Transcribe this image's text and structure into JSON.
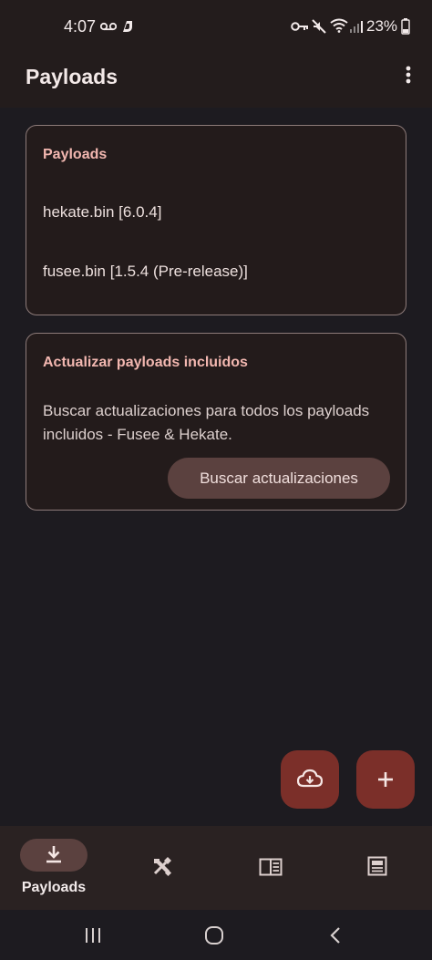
{
  "status_bar": {
    "time": "4:07",
    "battery": "23%",
    "icons": [
      "voicemail-icon",
      "app-d-icon",
      "key-icon",
      "mute-icon",
      "wifi-icon",
      "signal-icon",
      "battery-icon"
    ]
  },
  "app_bar": {
    "title": "Payloads",
    "menu_icon": "more-vert-icon"
  },
  "payloads_card": {
    "title": "Payloads",
    "items": [
      "hekate.bin [6.0.4]",
      "fusee.bin [1.5.4 (Pre-release)]"
    ]
  },
  "update_card": {
    "title": "Actualizar payloads incluidos",
    "description": "Buscar actualizaciones para todos los payloads incluidos - Fusee & Hekate.",
    "button_label": "Buscar actualizaciones"
  },
  "fabs": [
    {
      "icon": "cloud-download-icon"
    },
    {
      "icon": "plus-icon"
    }
  ],
  "bottom_nav": {
    "items": [
      {
        "icon": "download-icon",
        "label": "Payloads",
        "active": true
      },
      {
        "icon": "tools-icon",
        "label": "",
        "active": false
      },
      {
        "icon": "split-view-icon",
        "label": "",
        "active": false
      },
      {
        "icon": "article-icon",
        "label": "",
        "active": false
      }
    ]
  },
  "colors": {
    "background": "#1d1b20",
    "surface": "#231c1c",
    "accent": "#f2b7b0",
    "fab": "#7b2f29",
    "tonal": "#5b413f",
    "outline": "#8d7b79"
  }
}
